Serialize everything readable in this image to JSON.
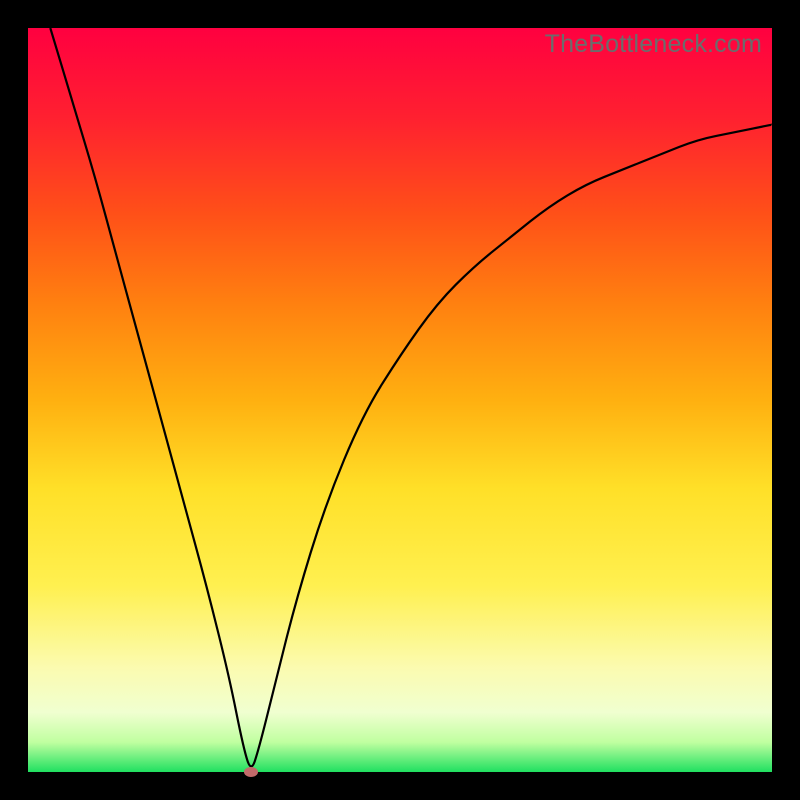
{
  "watermark": "TheBottleneck.com",
  "chart_data": {
    "type": "line",
    "title": "",
    "xlabel": "",
    "ylabel": "",
    "xlim": [
      0,
      100
    ],
    "ylim": [
      0,
      100
    ],
    "series": [
      {
        "name": "bottleneck-curve",
        "x": [
          3,
          6,
          9,
          12,
          15,
          18,
          21,
          24,
          27,
          29,
          30,
          31,
          33,
          36,
          40,
          45,
          50,
          55,
          60,
          65,
          70,
          75,
          80,
          85,
          90,
          95,
          100
        ],
        "y": [
          100,
          90,
          80,
          69,
          58,
          47,
          36,
          25,
          13,
          3,
          0,
          3,
          11,
          23,
          36,
          48,
          56,
          63,
          68,
          72,
          76,
          79,
          81,
          83,
          85,
          86,
          87
        ]
      }
    ],
    "marker": {
      "x": 30,
      "y": 0,
      "color": "#c26a6a"
    },
    "background_gradient": {
      "top": "#ff0040",
      "bottom": "#20e060",
      "stops": [
        "red",
        "orange",
        "yellow",
        "green"
      ]
    }
  }
}
